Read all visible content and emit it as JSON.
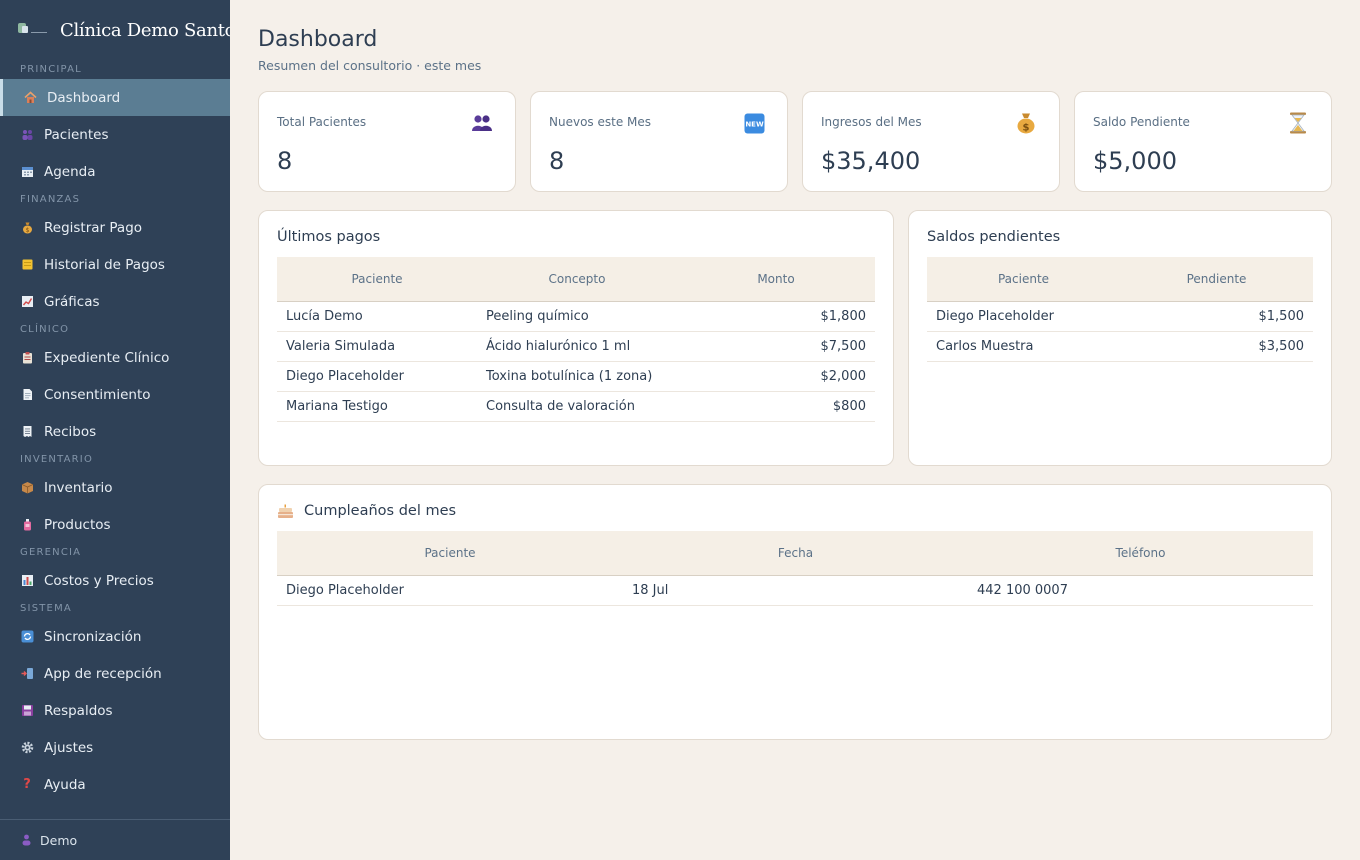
{
  "brand": {
    "title": "Clínica Demo Santo"
  },
  "sidebar": {
    "sections": [
      {
        "label": "PRINCIPAL"
      },
      {
        "label": "FINANZAS"
      },
      {
        "label": "CLÍNICO"
      },
      {
        "label": "INVENTARIO"
      },
      {
        "label": "GERENCIA"
      },
      {
        "label": "SISTEMA"
      }
    ],
    "items": [
      {
        "label": "Dashboard",
        "icon": "house-icon",
        "active": true
      },
      {
        "label": "Pacientes",
        "icon": "users-icon"
      },
      {
        "label": "Agenda",
        "icon": "calendar-icon"
      },
      {
        "label": "Registrar Pago",
        "icon": "money-bag-icon"
      },
      {
        "label": "Historial de Pagos",
        "icon": "ledger-icon"
      },
      {
        "label": "Gráficas",
        "icon": "chart-icon"
      },
      {
        "label": "Expediente Clínico",
        "icon": "clipboard-icon"
      },
      {
        "label": "Consentimiento",
        "icon": "document-icon"
      },
      {
        "label": "Recibos",
        "icon": "receipt-icon"
      },
      {
        "label": "Inventario",
        "icon": "package-icon"
      },
      {
        "label": "Productos",
        "icon": "bottle-icon"
      },
      {
        "label": "Costos y Precios",
        "icon": "bar-chart-icon"
      },
      {
        "label": "Sincronización",
        "icon": "sync-icon"
      },
      {
        "label": "App de recepción",
        "icon": "tablet-icon"
      },
      {
        "label": "Respaldos",
        "icon": "floppy-disk-icon"
      },
      {
        "label": "Ajustes",
        "icon": "gear-icon"
      },
      {
        "label": "Ayuda",
        "icon": "question-icon"
      }
    ],
    "footer_user": "Demo"
  },
  "header": {
    "title": "Dashboard",
    "subtitle": "Resumen del consultorio · este mes"
  },
  "stats": [
    {
      "label": "Total Pacientes",
      "value": "8",
      "icon": "users-icon"
    },
    {
      "label": "Nuevos este Mes",
      "value": "8",
      "icon": "new-badge-icon",
      "badge_text": "NEW"
    },
    {
      "label": "Ingresos del Mes",
      "value": "$35,400",
      "icon": "money-bag-icon"
    },
    {
      "label": "Saldo Pendiente",
      "value": "$5,000",
      "icon": "hourglass-icon"
    }
  ],
  "payments": {
    "title": "Últimos pagos",
    "columns": [
      "Paciente",
      "Concepto",
      "Monto"
    ],
    "rows": [
      [
        "Lucía Demo",
        "Peeling químico",
        "$1,800"
      ],
      [
        "Valeria Simulada",
        "Ácido hialurónico 1 ml",
        "$7,500"
      ],
      [
        "Diego Placeholder",
        "Toxina botulínica (1 zona)",
        "$2,000"
      ],
      [
        "Mariana Testigo",
        "Consulta de valoración",
        "$800"
      ]
    ]
  },
  "balances": {
    "title": "Saldos pendientes",
    "columns": [
      "Paciente",
      "Pendiente"
    ],
    "rows": [
      [
        "Diego Placeholder",
        "$1,500"
      ],
      [
        "Carlos Muestra",
        "$3,500"
      ]
    ]
  },
  "birthdays": {
    "title": "Cumpleaños del mes",
    "icon": "cake-icon",
    "columns": [
      "Paciente",
      "Fecha",
      "Teléfono"
    ],
    "rows": [
      [
        "Diego Placeholder",
        "18 Jul",
        "442 100 0007"
      ]
    ]
  },
  "colors": {
    "sidebar_bg": "#2f4157",
    "active_item_bg": "#5b7d93",
    "page_bg": "#f5f0ea",
    "table_header_bg": "#f5efe6"
  }
}
